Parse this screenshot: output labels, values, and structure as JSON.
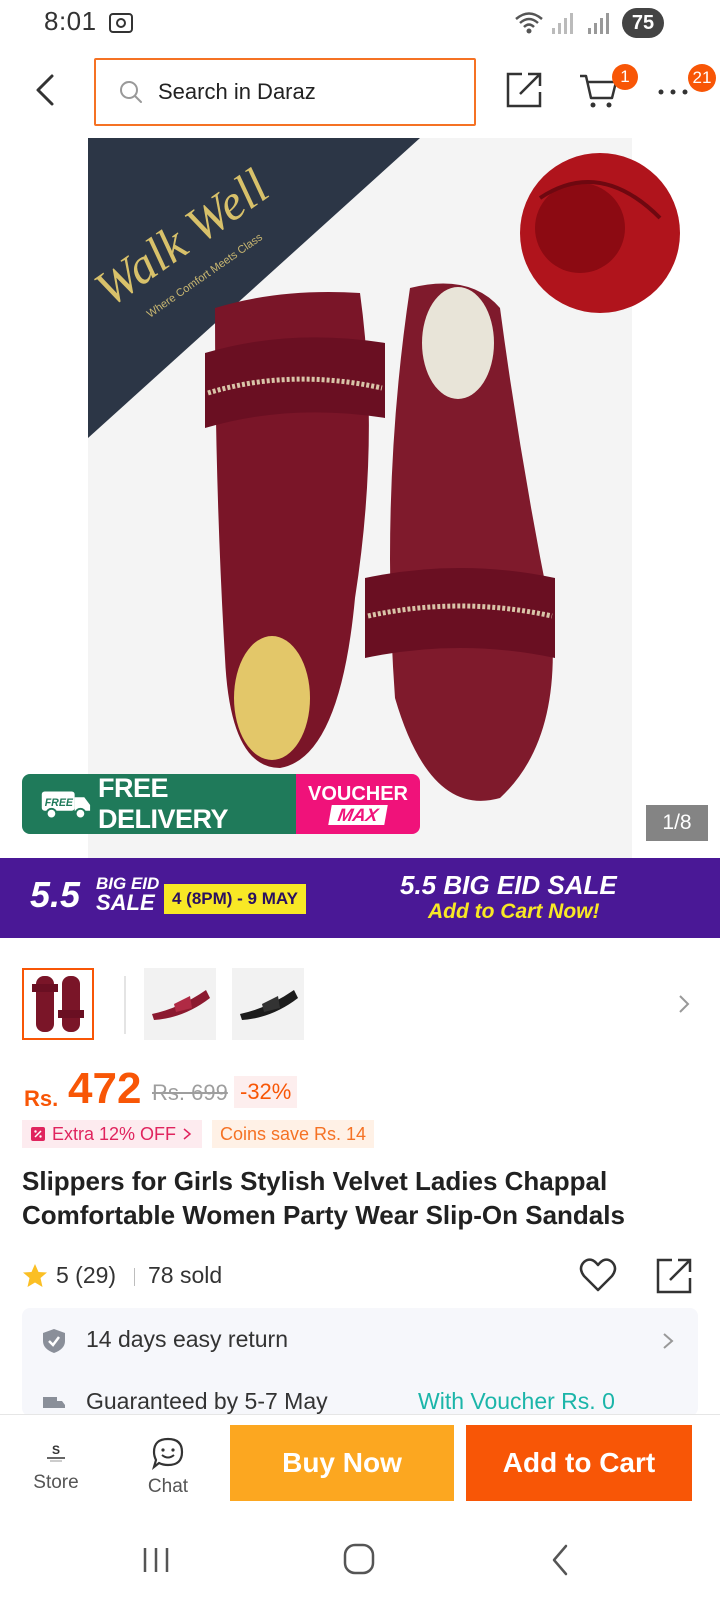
{
  "status_bar": {
    "time": "8:01",
    "battery": "75"
  },
  "search": {
    "placeholder": "Search in Daraz"
  },
  "header": {
    "cart_count": "1",
    "more_count": "21"
  },
  "gallery": {
    "box_brand": "Walk Well",
    "box_tagline": "Where Comfort Meets Class",
    "counter": "1/8"
  },
  "badges": {
    "free_tag": "FREE",
    "free_delivery": "FREE DELIVERY",
    "voucher_top": "VOUCHER",
    "voucher_bottom": "MAX"
  },
  "sale_banner": {
    "num": "5.5",
    "big_eid": "BIG EID",
    "sale": "SALE",
    "dates": "4 (8PM) - 9 MAY",
    "title": "5.5 BIG EID SALE",
    "subtitle": "Add to Cart Now!"
  },
  "product": {
    "currency": "Rs.",
    "price": "472",
    "old_price": "Rs. 699",
    "discount": "-32%",
    "extra_off": "Extra 12% OFF",
    "coins_save": "Coins save Rs. 14",
    "title": "Slippers for Girls Stylish Velvet Ladies Chappal Comfortable Women Party Wear Slip-On Sandals",
    "rating": "5 (29)",
    "sold": "78 sold"
  },
  "info": {
    "return": "14 days easy return",
    "delivery": "Guaranteed by 5-7 May",
    "voucher": "With Voucher Rs. 0"
  },
  "bottom": {
    "store": "Store",
    "chat": "Chat",
    "buy_now": "Buy Now",
    "add_to_cart": "Add to Cart"
  },
  "colors": {
    "accent": "#f85606",
    "buy_now": "#fca720",
    "sale_banner": "#4a1896",
    "free_delivery": "#1f7a5a",
    "voucher_max": "#f0127a"
  }
}
